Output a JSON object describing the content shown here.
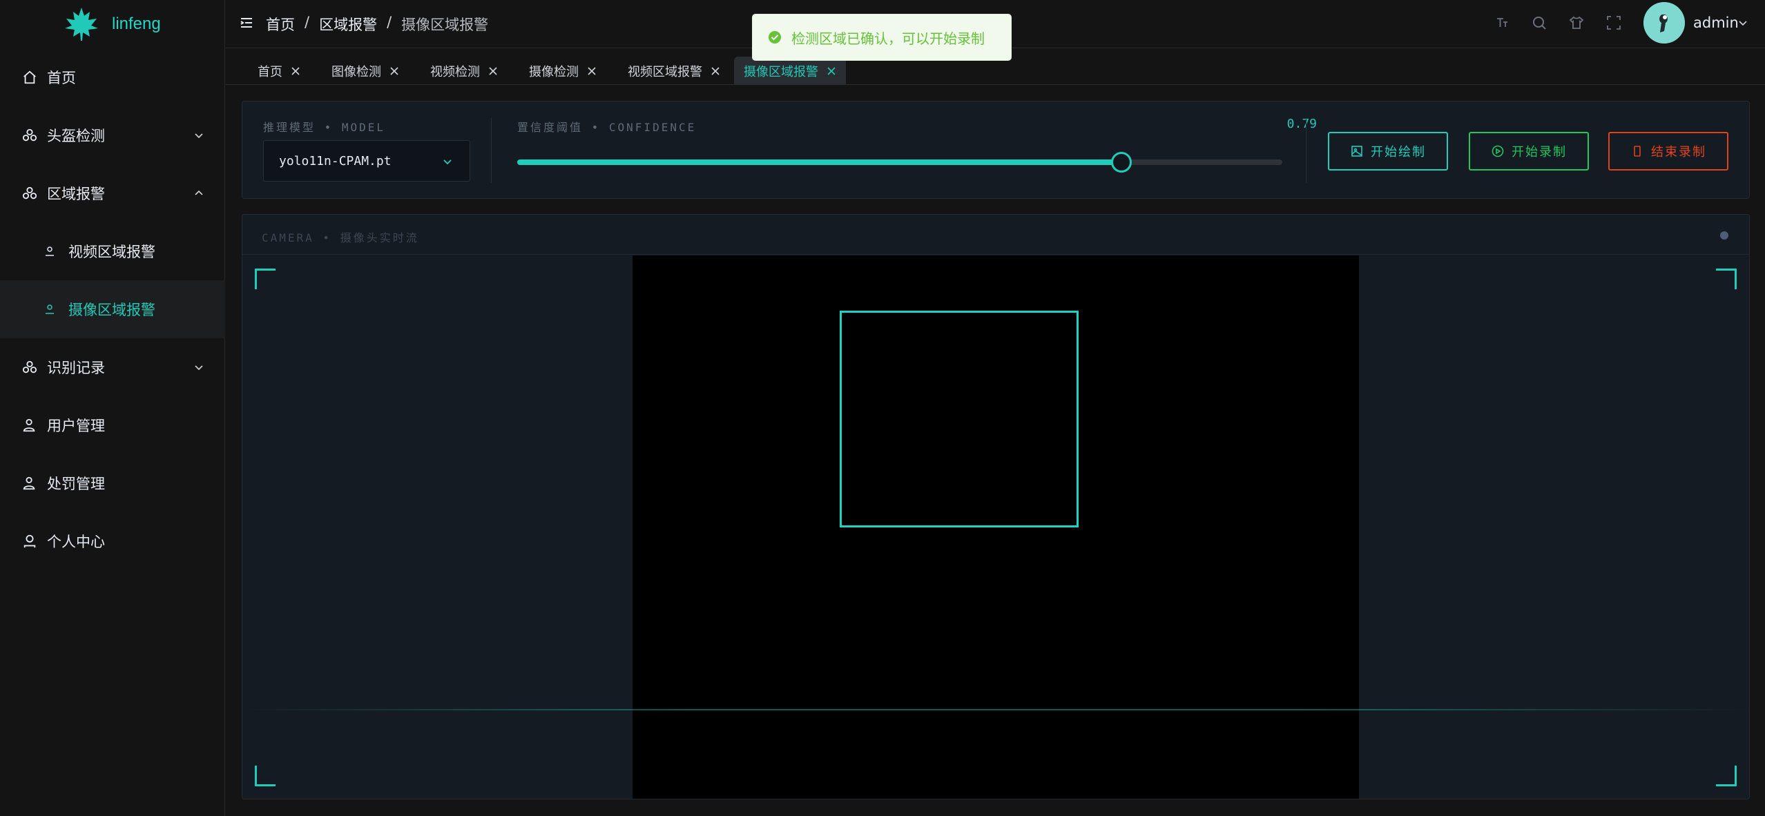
{
  "app": {
    "name": "linfeng"
  },
  "sidebar": {
    "items": [
      {
        "label": "首页"
      },
      {
        "label": "头盔检测"
      },
      {
        "label": "区域报警"
      },
      {
        "label": "视频区域报警"
      },
      {
        "label": "摄像区域报警"
      },
      {
        "label": "识别记录"
      },
      {
        "label": "用户管理"
      },
      {
        "label": "处罚管理"
      },
      {
        "label": "个人中心"
      }
    ]
  },
  "header": {
    "breadcrumb": [
      "首页",
      "区域报警",
      "摄像区域报警"
    ],
    "separator": "/",
    "user": "admin"
  },
  "tabs": [
    {
      "label": "首页"
    },
    {
      "label": "图像检测"
    },
    {
      "label": "视频检测"
    },
    {
      "label": "摄像检测"
    },
    {
      "label": "视频区域报警"
    },
    {
      "label": "摄像区域报警",
      "active": true
    }
  ],
  "controls": {
    "model_label": "推理模型 • MODEL",
    "model_value": "yolo11n-CPAM.pt",
    "confidence_label": "置信度阈值 • CONFIDENCE",
    "confidence_value": "0.79",
    "confidence_fraction": 0.79,
    "btn_draw": "开始绘制",
    "btn_start": "开始录制",
    "btn_stop": "结束录制"
  },
  "camera": {
    "label": "CAMERA • 摄像头实时流"
  },
  "toast": {
    "message": "检测区域已确认，可以开始录制"
  },
  "colors": {
    "accent": "#1fcdbb",
    "success": "#22c55e",
    "danger": "#e0431e",
    "toast_text": "#67c23a"
  }
}
